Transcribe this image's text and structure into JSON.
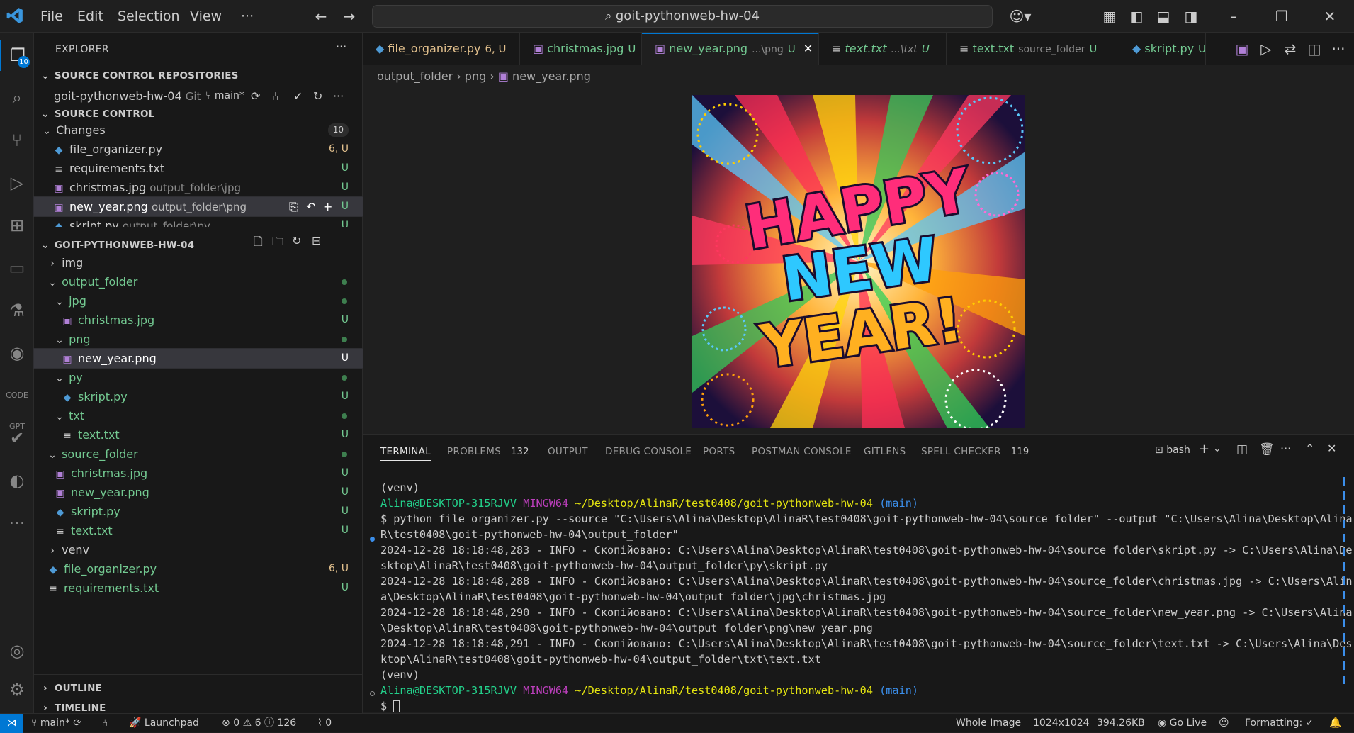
{
  "titlebar": {
    "menus": [
      "File",
      "Edit",
      "Selection",
      "View"
    ],
    "more": "···",
    "search": "goit-pythonweb-hw-04"
  },
  "activity_badge": "10",
  "sidebar": {
    "title": "EXPLORER",
    "repos_header": "SOURCE CONTROL REPOSITORIES",
    "repo": {
      "name": "goit-pythonweb-hw-04",
      "type": "Git",
      "branch": "main*"
    },
    "sc_header": "SOURCE CONTROL",
    "changes_label": "Changes",
    "changes_count": "10",
    "changes": [
      {
        "name": "file_organizer.py",
        "path": "",
        "status": "6, U",
        "icon": "python-file-icon"
      },
      {
        "name": "requirements.txt",
        "path": "",
        "status": "U",
        "icon": "text-file-icon"
      },
      {
        "name": "christmas.jpg",
        "path": "output_folder\\jpg",
        "status": "U",
        "icon": "image-file-icon"
      },
      {
        "name": "new_year.png",
        "path": "output_folder\\png",
        "status": "U",
        "icon": "image-file-icon"
      },
      {
        "name": "skript.py",
        "path": "output_folder\\py",
        "status": "U",
        "icon": "python-file-icon"
      }
    ],
    "workspace_header": "GOIT-PYTHONWEB-HW-04",
    "tree": [
      {
        "name": "img",
        "status": ""
      },
      {
        "name": "output_folder",
        "status": ""
      },
      {
        "name": "jpg",
        "status": ""
      },
      {
        "name": "christmas.jpg",
        "status": "U"
      },
      {
        "name": "png",
        "status": ""
      },
      {
        "name": "new_year.png",
        "status": "U"
      },
      {
        "name": "py",
        "status": ""
      },
      {
        "name": "skript.py",
        "status": "U"
      },
      {
        "name": "txt",
        "status": ""
      },
      {
        "name": "text.txt",
        "status": "U"
      },
      {
        "name": "source_folder",
        "status": ""
      },
      {
        "name": "christmas.jpg",
        "status": "U"
      },
      {
        "name": "new_year.png",
        "status": "U"
      },
      {
        "name": "skript.py",
        "status": "U"
      },
      {
        "name": "text.txt",
        "status": "U"
      },
      {
        "name": "venv",
        "status": ""
      },
      {
        "name": "file_organizer.py",
        "status": "6, U"
      },
      {
        "name": "requirements.txt",
        "status": "U"
      }
    ],
    "outline": "OUTLINE",
    "timeline": "TIMELINE"
  },
  "tabs": [
    {
      "name": "file_organizer.py",
      "sub": "",
      "status": "6, U"
    },
    {
      "name": "christmas.jpg",
      "sub": "",
      "status": "U"
    },
    {
      "name": "new_year.png",
      "sub": "...\\png",
      "status": "U"
    },
    {
      "name": "text.txt",
      "sub": "...\\txt",
      "status": "U"
    },
    {
      "name": "text.txt",
      "sub": "source_folder",
      "status": "U"
    },
    {
      "name": "skript.py",
      "sub": "",
      "status": "U"
    }
  ],
  "breadcrumb": [
    "output_folder",
    "png",
    "new_year.png"
  ],
  "preview": {
    "line1": "HAPPY",
    "line2": "NEW",
    "line3": "YEAR!"
  },
  "panel": {
    "tabs": [
      "TERMINAL",
      "PROBLEMS",
      "OUTPUT",
      "DEBUG CONSOLE",
      "PORTS",
      "POSTMAN CONSOLE",
      "GITLENS",
      "SPELL CHECKER"
    ],
    "problems_count": "132",
    "spell_count": "119",
    "shell": "bash"
  },
  "terminal": {
    "venv": "(venv)",
    "user": "Alina@DESKTOP-315RJVV",
    "env": "MINGW64",
    "path": "~/Desktop/AlinaR/test0408/goit-pythonweb-hw-04",
    "branch": "(main)",
    "lines": [
      "$ python file_organizer.py --source \"C:\\Users\\Alina\\Desktop\\AlinaR\\test0408\\goit-pythonweb-hw-04\\source_folder\" --output \"C:\\Users\\Alina\\Desktop\\Alina",
      "R\\test0408\\goit-pythonweb-hw-04\\output_folder\"",
      "2024-12-28 18:18:48,283 - INFO - Скопійовано: C:\\Users\\Alina\\Desktop\\AlinaR\\test0408\\goit-pythonweb-hw-04\\source_folder\\skript.py -> C:\\Users\\Alina\\De",
      "sktop\\AlinaR\\test0408\\goit-pythonweb-hw-04\\output_folder\\py\\skript.py",
      "2024-12-28 18:18:48,288 - INFO - Скопійовано: C:\\Users\\Alina\\Desktop\\AlinaR\\test0408\\goit-pythonweb-hw-04\\source_folder\\christmas.jpg -> C:\\Users\\Alin",
      "a\\Desktop\\AlinaR\\test0408\\goit-pythonweb-hw-04\\output_folder\\jpg\\christmas.jpg",
      "2024-12-28 18:18:48,290 - INFO - Скопійовано: C:\\Users\\Alina\\Desktop\\AlinaR\\test0408\\goit-pythonweb-hw-04\\source_folder\\new_year.png -> C:\\Users\\Alina",
      "\\Desktop\\AlinaR\\test0408\\goit-pythonweb-hw-04\\output_folder\\png\\new_year.png",
      "2024-12-28 18:18:48,291 - INFO - Скопійовано: C:\\Users\\Alina\\Desktop\\AlinaR\\test0408\\goit-pythonweb-hw-04\\source_folder\\text.txt -> C:\\Users\\Alina\\Des",
      "ktop\\AlinaR\\test0408\\goit-pythonweb-hw-04\\output_folder\\txt\\text.txt"
    ],
    "prompt": "$"
  },
  "status": {
    "branch": "main*",
    "launchpad": "Launchpad",
    "errors": "0",
    "warnings": "6",
    "infos": "126",
    "ports": "0",
    "whole_image": "Whole Image",
    "size": "1024x1024",
    "filesize": "394.26KB",
    "golive": "Go Live",
    "formatting": "Formatting: ✓"
  },
  "colors": {
    "accent": "#0078d4",
    "untracked": "#73c991",
    "modified": "#e2c08d",
    "terminal_green": "#23d18b",
    "terminal_purple": "#bc3fbc",
    "terminal_yellow": "#e5e510"
  }
}
